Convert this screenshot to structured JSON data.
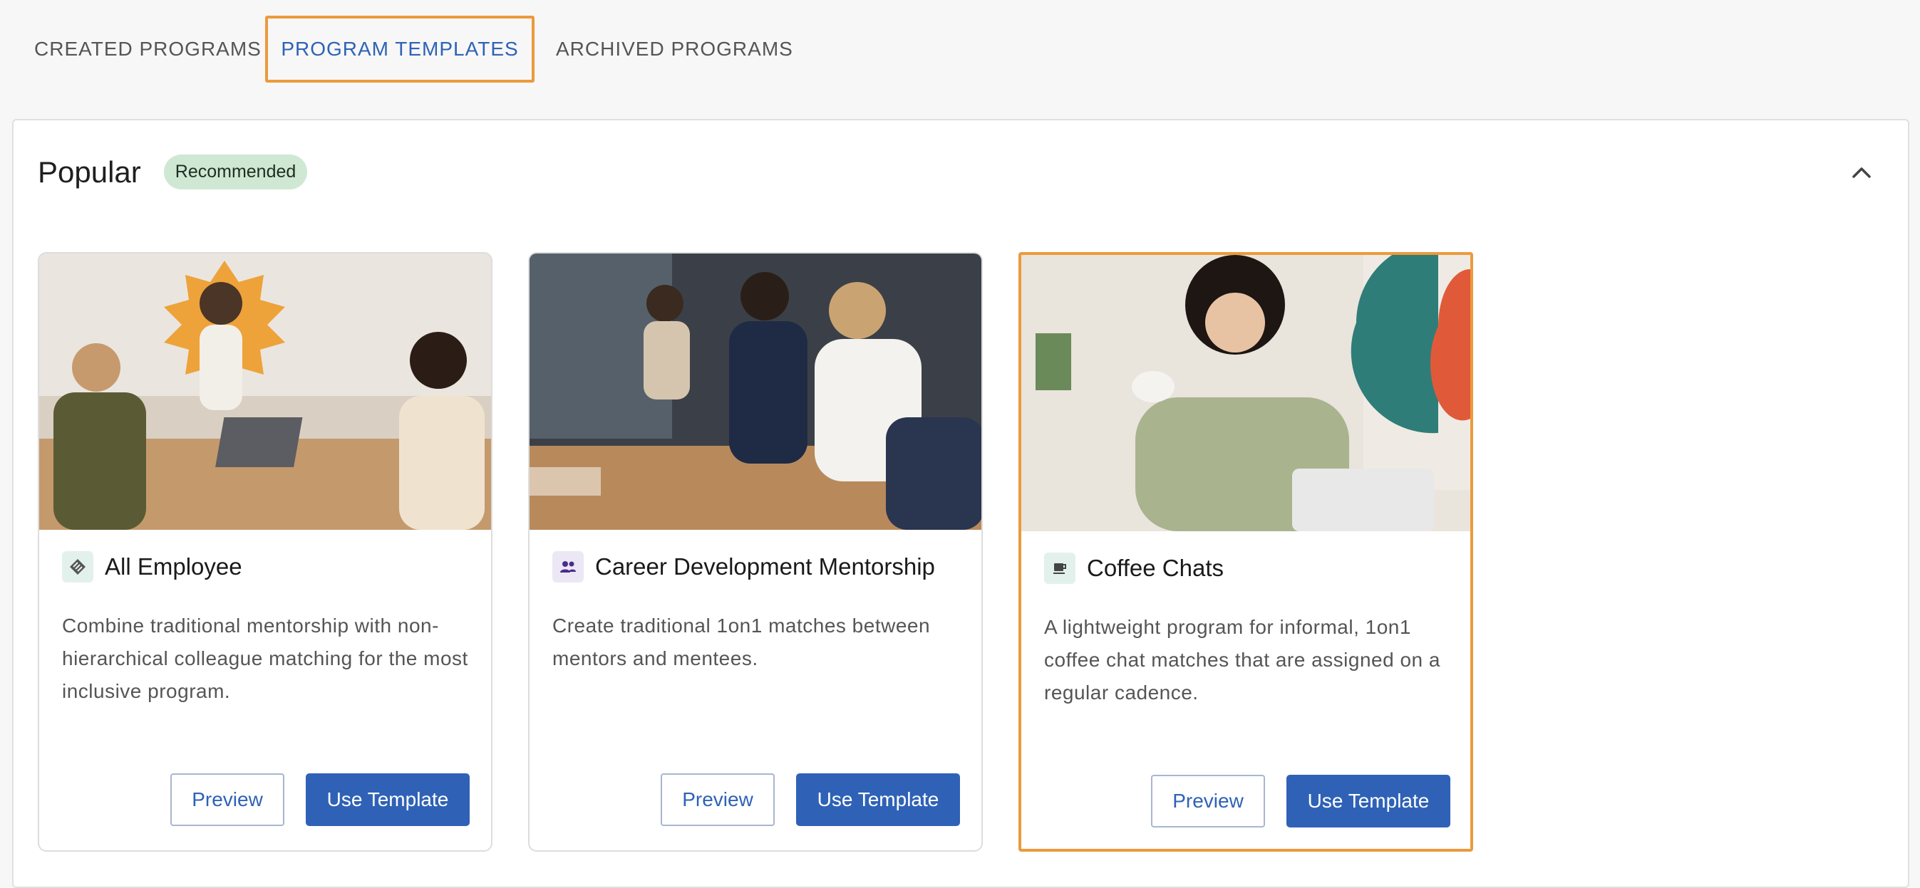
{
  "tabs": [
    {
      "label": "CREATED PROGRAMS",
      "active": false
    },
    {
      "label": "PROGRAM TEMPLATES",
      "active": true
    },
    {
      "label": "ARCHIVED PROGRAMS",
      "active": false
    }
  ],
  "section": {
    "title": "Popular",
    "badge": "Recommended",
    "collapse_icon": "chevron-up-icon"
  },
  "cards": [
    {
      "title": "All Employee",
      "icon": "all-employee-icon",
      "description": "Combine traditional mentorship with non-hierarchical colleague matching for the most inclusive program.",
      "preview_label": "Preview",
      "use_label": "Use Template"
    },
    {
      "title": "Career Development Mentorship",
      "icon": "people-icon",
      "description": "Create traditional 1on1 matches between mentors and mentees.",
      "preview_label": "Preview",
      "use_label": "Use Template"
    },
    {
      "title": "Coffee Chats",
      "icon": "coffee-cup-icon",
      "description": "A lightweight program for informal, 1on1 coffee chat matches that are assigned on a regular cadence.",
      "preview_label": "Preview",
      "use_label": "Use Template"
    }
  ],
  "colors": {
    "accent": "#2f62b6",
    "focus_outline": "#ec9a3c",
    "badge_bg": "#cfe8d3"
  }
}
